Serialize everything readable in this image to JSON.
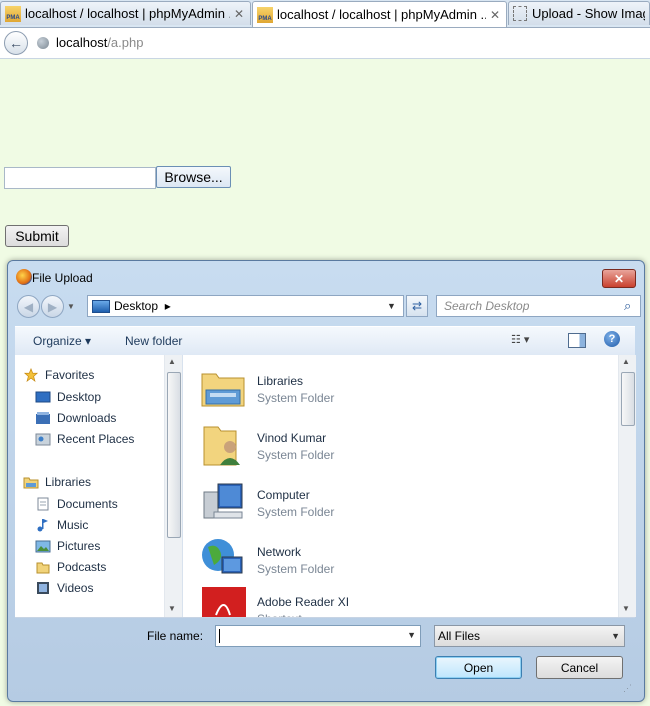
{
  "browser": {
    "tabs": [
      {
        "label": "localhost / localhost | phpMyAdmin ...",
        "icon": "phpmyadmin-icon",
        "active": false
      },
      {
        "label": "localhost / localhost | phpMyAdmin ...",
        "icon": "phpmyadmin-icon",
        "active": true
      },
      {
        "label": "Upload - Show Image",
        "icon": "blank-page-icon",
        "active": false
      }
    ],
    "pma_text": "PMA",
    "url_host": "localhost",
    "url_path": "/a.php"
  },
  "page": {
    "file_input_value": "",
    "browse_label": "Browse...",
    "submit_label": "Submit"
  },
  "dialog": {
    "title": "File Upload",
    "close_glyph": "✕",
    "location": "Desktop",
    "search_placeholder": "Search Desktop",
    "toolbar": {
      "organize": "Organize ▾",
      "new_folder": "New folder"
    },
    "help_glyph": "?",
    "nav_items": [
      {
        "label": "Favorites",
        "icon": "star-icon",
        "group": true
      },
      {
        "label": "Desktop",
        "icon": "desktop-icon",
        "group": false
      },
      {
        "label": "Downloads",
        "icon": "downloads-icon",
        "group": false
      },
      {
        "label": "Recent Places",
        "icon": "recent-places-icon",
        "group": false
      },
      {
        "label": "Libraries",
        "icon": "libraries-icon",
        "group": true
      },
      {
        "label": "Documents",
        "icon": "documents-icon",
        "group": false
      },
      {
        "label": "Music",
        "icon": "music-icon",
        "group": false
      },
      {
        "label": "Pictures",
        "icon": "pictures-icon",
        "group": false
      },
      {
        "label": "Podcasts",
        "icon": "podcasts-icon",
        "group": false
      },
      {
        "label": "Videos",
        "icon": "videos-icon",
        "group": false
      }
    ],
    "items": [
      {
        "name": "Libraries",
        "type": "System Folder",
        "icon": "libraries-folder-icon"
      },
      {
        "name": "Vinod Kumar",
        "type": "System Folder",
        "icon": "user-folder-icon"
      },
      {
        "name": "Computer",
        "type": "System Folder",
        "icon": "computer-icon"
      },
      {
        "name": "Network",
        "type": "System Folder",
        "icon": "network-icon"
      },
      {
        "name": "Adobe Reader XI",
        "type": "Shortcut",
        "icon": "adobe-reader-icon"
      }
    ],
    "file_name_label": "File name:",
    "file_name_value": "",
    "filter_value": "All Files",
    "open_label": "Open",
    "cancel_label": "Cancel"
  },
  "colors": {
    "page_background": "#f0fbe4",
    "dialog_frame": "#b5cbe3",
    "close_button": "#c9412f",
    "open_button": "#bee6fd"
  }
}
